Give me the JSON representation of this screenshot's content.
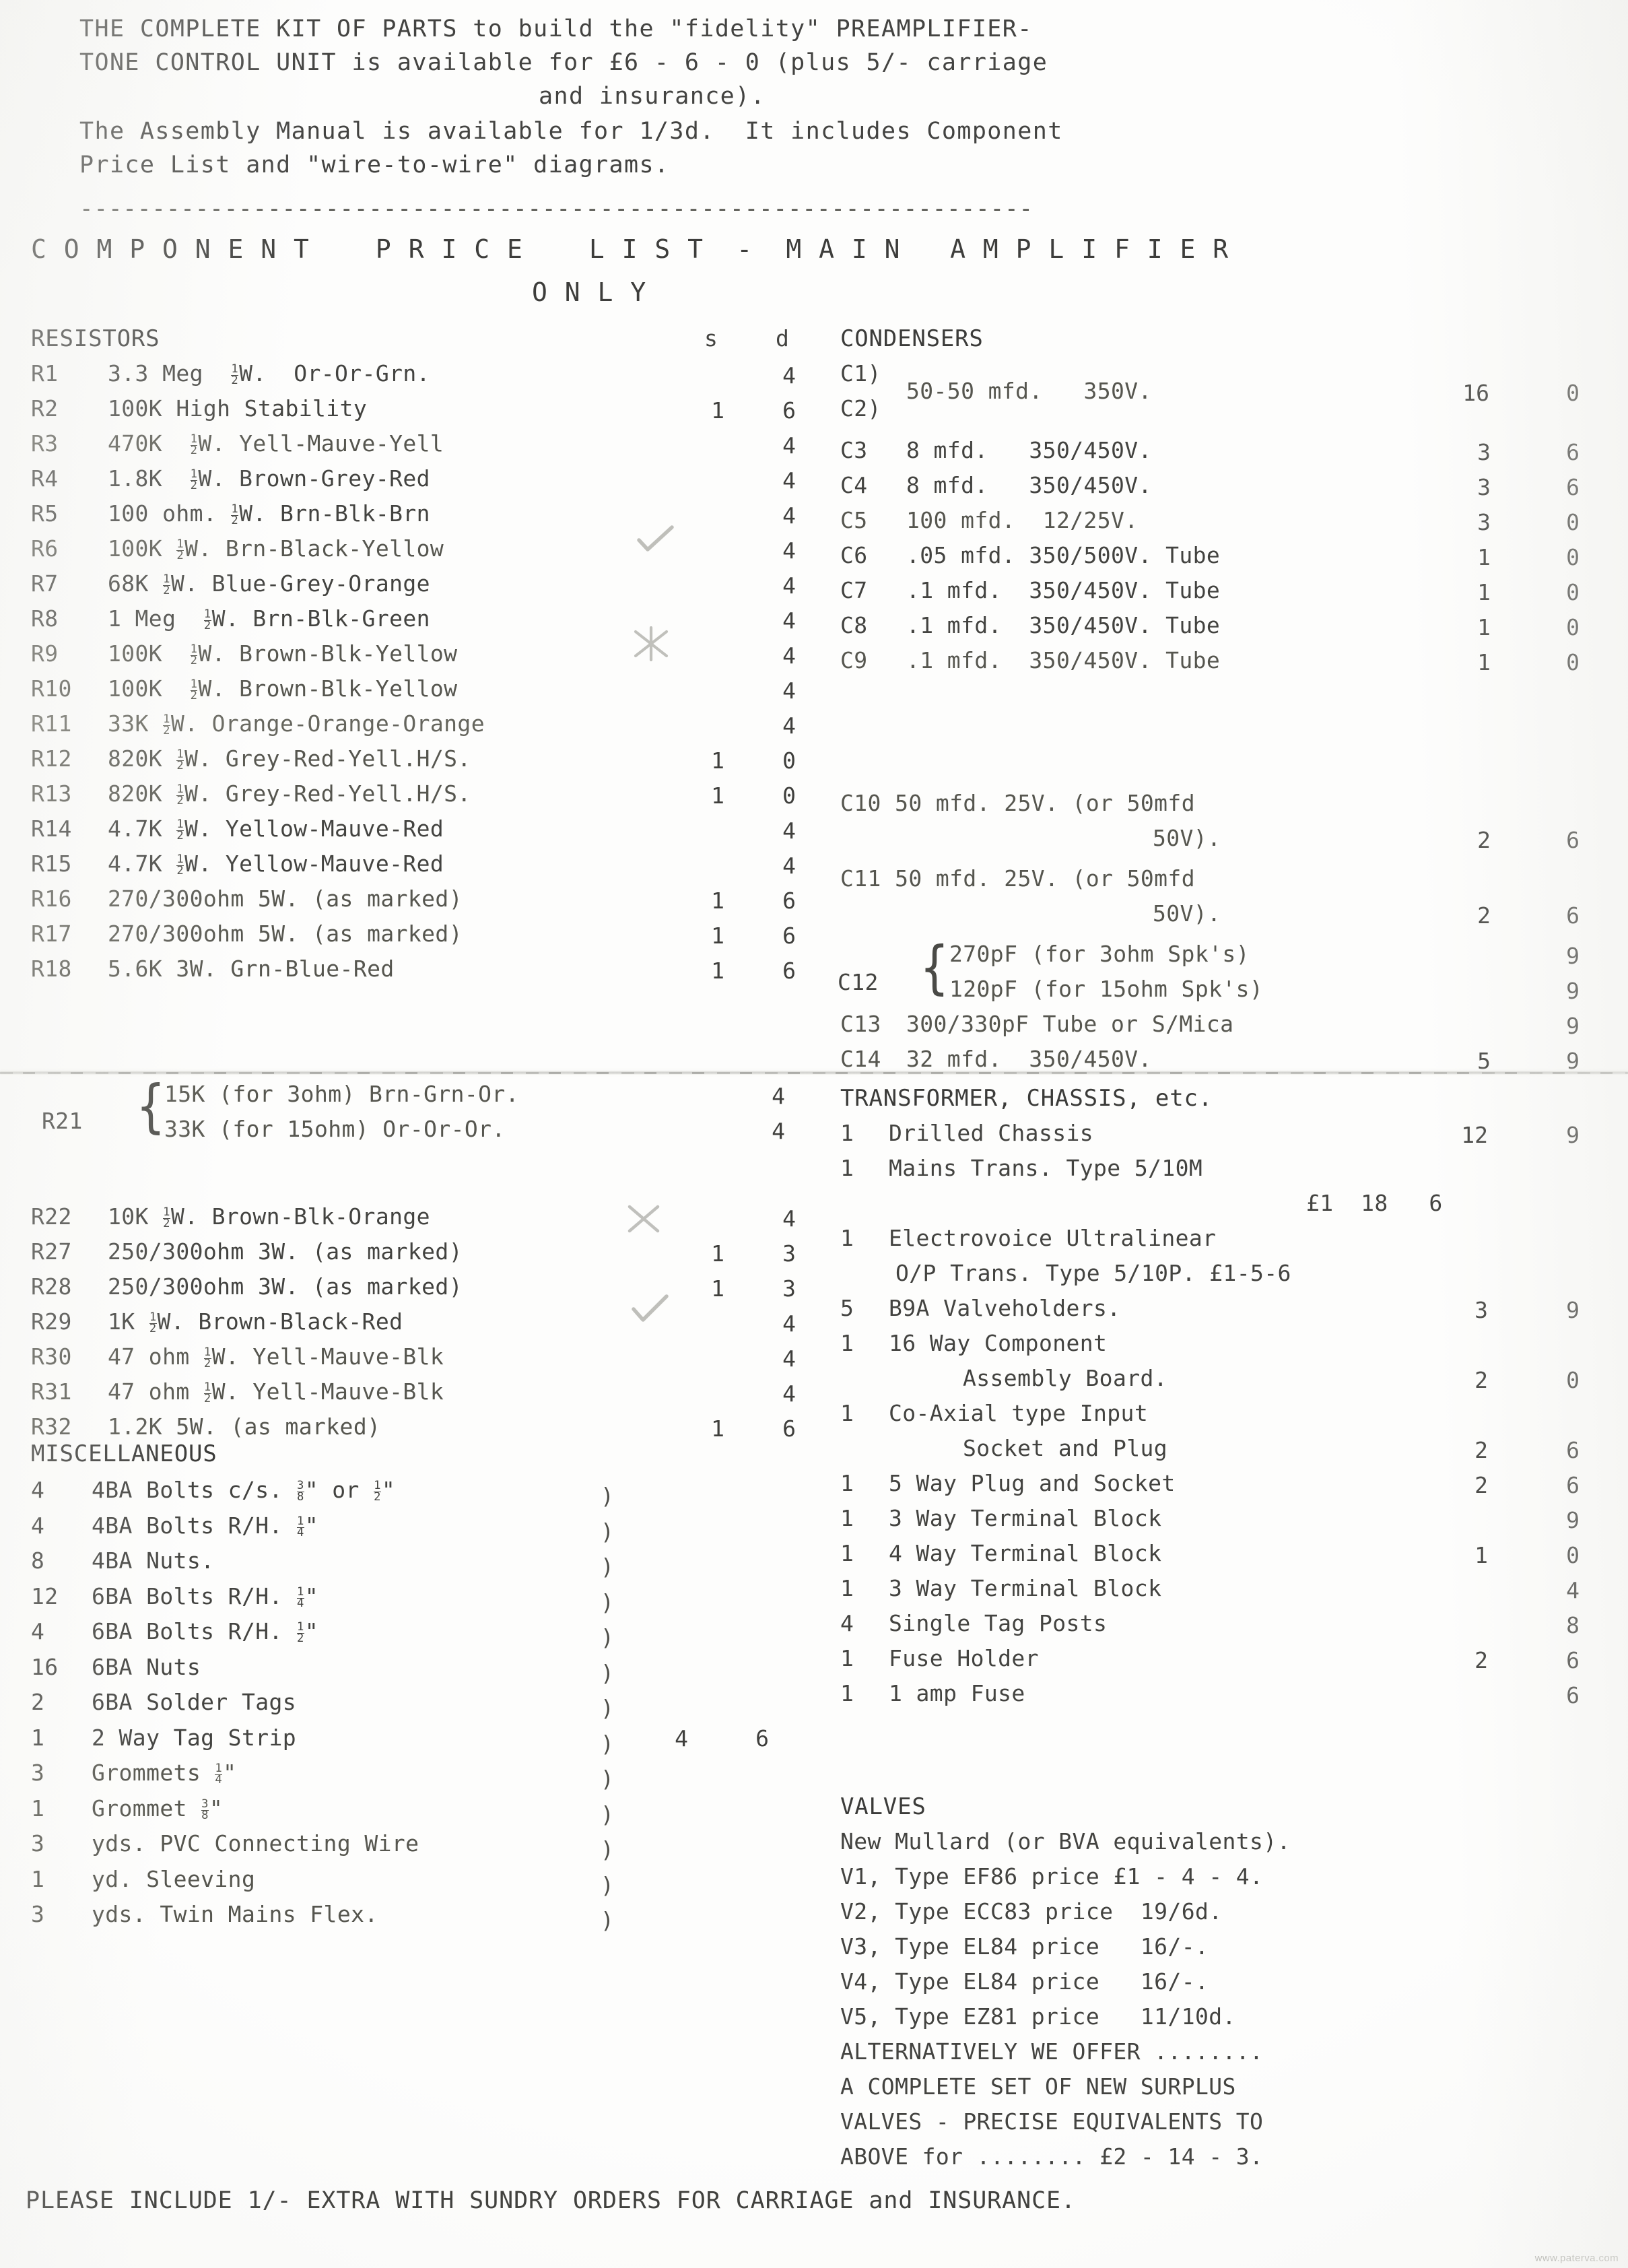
{
  "header": {
    "line1": "THE COMPLETE KIT OF PARTS to build the \"fidelity\" PREAMPLIFIER-",
    "line2": "TONE CONTROL UNIT is available for £6 - 6 - 0 (plus 5/- carriage",
    "line3": "and insurance).",
    "line4": "The Assembly Manual is available for 1/3d.  It includes Component",
    "line5": "Price List and \"wire-to-wire\" diagrams.",
    "divider": "------------------------------------------------------------------"
  },
  "title": {
    "line1": "C O M P O N E N T    P R I C E    L I S T  -  M A I N   A M P L I F I E R",
    "line2": "O N L Y"
  },
  "columns": {
    "shillings_header": "s",
    "pence_header": "d"
  },
  "resistors": {
    "heading": "RESISTORS",
    "items": [
      {
        "ref": "R1",
        "desc": "3.3 Meg  ½W.  Or-Or-Grn.",
        "s": "",
        "d": "4"
      },
      {
        "ref": "R2",
        "desc": "100K High Stability",
        "s": "1",
        "d": "6"
      },
      {
        "ref": "R3",
        "desc": "470K  ½W. Yell-Mauve-Yell",
        "s": "",
        "d": "4"
      },
      {
        "ref": "R4",
        "desc": "1.8K  ½W. Brown-Grey-Red",
        "s": "",
        "d": "4"
      },
      {
        "ref": "R5",
        "desc": "100 ohm. ½W. Brn-Blk-Brn",
        "s": "",
        "d": "4"
      },
      {
        "ref": "R6",
        "desc": "100K ½W. Brn-Black-Yellow",
        "s": "",
        "d": "4"
      },
      {
        "ref": "R7",
        "desc": "68K ½W. Blue-Grey-Orange",
        "s": "",
        "d": "4"
      },
      {
        "ref": "R8",
        "desc": "1 Meg  ½W. Brn-Blk-Green",
        "s": "",
        "d": "4"
      },
      {
        "ref": "R9",
        "desc": "100K  ½W. Brown-Blk-Yellow",
        "s": "",
        "d": "4"
      },
      {
        "ref": "R10",
        "desc": "100K  ½W. Brown-Blk-Yellow",
        "s": "",
        "d": "4"
      },
      {
        "ref": "R11",
        "desc": "33K ½W. Orange-Orange-Orange",
        "s": "",
        "d": "4"
      },
      {
        "ref": "R12",
        "desc": "820K ½W. Grey-Red-Yell.H/S.",
        "s": "1",
        "d": "0"
      },
      {
        "ref": "R13",
        "desc": "820K ½W. Grey-Red-Yell.H/S.",
        "s": "1",
        "d": "0"
      },
      {
        "ref": "R14",
        "desc": "4.7K ½W. Yellow-Mauve-Red",
        "s": "",
        "d": "4"
      },
      {
        "ref": "R15",
        "desc": "4.7K ½W. Yellow-Mauve-Red",
        "s": "",
        "d": "4"
      },
      {
        "ref": "R16",
        "desc": "270/300ohm 5W. (as marked)",
        "s": "1",
        "d": "6"
      },
      {
        "ref": "R17",
        "desc": "270/300ohm 5W. (as marked)",
        "s": "1",
        "d": "6"
      },
      {
        "ref": "R18",
        "desc": "5.6K 3W. Grn-Blue-Red",
        "s": "1",
        "d": "6"
      }
    ],
    "r21": {
      "ref": "R21",
      "line_a": "15K (for 3ohm) Brn-Grn-Or.",
      "line_b": "33K (for 15ohm) Or-Or-Or.",
      "d_a": "4",
      "d_b": "4"
    },
    "items_after": [
      {
        "ref": "R22",
        "desc": "10K ½W. Brown-Blk-Orange",
        "s": "",
        "d": "4"
      },
      {
        "ref": "R27",
        "desc": "250/300ohm 3W. (as marked)",
        "s": "1",
        "d": "3"
      },
      {
        "ref": "R28",
        "desc": "250/300ohm 3W. (as marked)",
        "s": "1",
        "d": "3"
      },
      {
        "ref": "R29",
        "desc": "1K ½W. Brown-Black-Red",
        "s": "",
        "d": "4"
      },
      {
        "ref": "R30",
        "desc": "47 ohm ½W. Yell-Mauve-Blk",
        "s": "",
        "d": "4"
      },
      {
        "ref": "R31",
        "desc": "47 ohm ½W. Yell-Mauve-Blk",
        "s": "",
        "d": "4"
      },
      {
        "ref": "R32",
        "desc": "1.2K 5W. (as marked)",
        "s": "1",
        "d": "6"
      }
    ]
  },
  "miscellaneous": {
    "heading": "MISCELLANEOUS",
    "items": [
      {
        "qty": "4",
        "desc": "4BA Bolts c/s. ⅜\" or ½\""
      },
      {
        "qty": "4",
        "desc": "4BA Bolts R/H. ¼\""
      },
      {
        "qty": "8",
        "desc": "4BA Nuts."
      },
      {
        "qty": "12",
        "desc": "6BA Bolts R/H. ¼\""
      },
      {
        "qty": "4",
        "desc": "6BA Bolts R/H. ½\""
      },
      {
        "qty": "16",
        "desc": "6BA Nuts"
      },
      {
        "qty": "2",
        "desc": "6BA Solder Tags"
      },
      {
        "qty": "1",
        "desc": "2 Way Tag Strip"
      },
      {
        "qty": "3",
        "desc": "Grommets ¼\""
      },
      {
        "qty": "1",
        "desc": "Grommet ⅜\""
      },
      {
        "qty": "3",
        "desc": "yds. PVC Connecting Wire"
      },
      {
        "qty": "1",
        "desc": "yd. Sleeving"
      },
      {
        "qty": "3",
        "desc": "yds. Twin Mains Flex."
      }
    ],
    "group_price": {
      "s": "4",
      "d": "6"
    }
  },
  "condensers": {
    "heading": "CONDENSERS",
    "c1c2": {
      "ref_a": "C1)",
      "ref_b": "C2)",
      "desc": "50-50 mfd.   350V.",
      "s": "16",
      "d": "0"
    },
    "items": [
      {
        "ref": "C3",
        "desc": "8 mfd.   350/450V.",
        "s": "3",
        "d": "6"
      },
      {
        "ref": "C4",
        "desc": "8 mfd.   350/450V.",
        "s": "3",
        "d": "6"
      },
      {
        "ref": "C5",
        "desc": "100 mfd.  12/25V.",
        "s": "3",
        "d": "0"
      },
      {
        "ref": "C6",
        "desc": ".05 mfd. 350/500V. Tube",
        "s": "1",
        "d": "0"
      },
      {
        "ref": "C7",
        "desc": ".1 mfd.  350/450V. Tube",
        "s": "1",
        "d": "0"
      },
      {
        "ref": "C8",
        "desc": ".1 mfd.  350/450V. Tube",
        "s": "1",
        "d": "0"
      },
      {
        "ref": "C9",
        "desc": ".1 mfd.  350/450V. Tube",
        "s": "1",
        "d": "0"
      }
    ],
    "c10": {
      "line_a": "C10 50 mfd. 25V. (or 50mfd",
      "line_b": "50V).",
      "s": "2",
      "d": "6"
    },
    "c11": {
      "line_a": "C11 50 mfd. 25V. (or 50mfd",
      "line_b": "50V).",
      "s": "2",
      "d": "6"
    },
    "c12": {
      "ref": "C12",
      "line_a": "270pF (for 3ohm Spk's)",
      "line_b": "120pF (for 15ohm Spk's)",
      "d_a": "9",
      "d_b": "9"
    },
    "items_after": [
      {
        "ref": "C13",
        "desc": "300/330pF Tube or S/Mica",
        "s": "",
        "d": "9"
      },
      {
        "ref": "C14",
        "desc": "32 mfd.  350/450V.",
        "s": "5",
        "d": "9"
      }
    ]
  },
  "transformer": {
    "heading": "TRANSFORMER, CHASSIS, etc.",
    "items": [
      {
        "qty": "1",
        "desc": "Drilled Chassis",
        "desc2": "",
        "s": "12",
        "d": "9"
      },
      {
        "qty": "1",
        "desc": "Mains Trans. Type 5/10M",
        "desc2": "£1  18   6",
        "s": "",
        "d": "",
        "pound": true
      },
      {
        "qty": "1",
        "desc": "Electrovoice Ultralinear",
        "desc2": "O/P Trans. Type 5/10P. £1-5-6",
        "s": "",
        "d": ""
      },
      {
        "qty": "5",
        "desc": "B9A Valveholders.",
        "desc2": "",
        "s": "3",
        "d": "9"
      },
      {
        "qty": "1",
        "desc": "16 Way Component",
        "desc2": "Assembly Board.",
        "s": "2",
        "d": "0"
      },
      {
        "qty": "1",
        "desc": "Co-Axial type Input",
        "desc2": "Socket and Plug",
        "s": "2",
        "d": "6"
      },
      {
        "qty": "1",
        "desc": "5 Way Plug and Socket",
        "desc2": "",
        "s": "2",
        "d": "6"
      },
      {
        "qty": "1",
        "desc": "3 Way Terminal Block",
        "desc2": "",
        "s": "",
        "d": "9"
      },
      {
        "qty": "1",
        "desc": "4 Way Terminal Block",
        "desc2": "",
        "s": "1",
        "d": "0"
      },
      {
        "qty": "1",
        "desc": "3 Way Terminal Block",
        "desc2": "",
        "s": "",
        "d": "4"
      },
      {
        "qty": "4",
        "desc": "Single Tag Posts",
        "desc2": "",
        "s": "",
        "d": "8"
      },
      {
        "qty": "1",
        "desc": "Fuse Holder",
        "desc2": "",
        "s": "2",
        "d": "6"
      },
      {
        "qty": "1",
        "desc": "1 amp Fuse",
        "desc2": "",
        "s": "",
        "d": "6"
      }
    ]
  },
  "valves": {
    "heading": "VALVES",
    "note": "New Mullard (or BVA equivalents).",
    "items": [
      "V1, Type EF86 price £1 - 4 - 4.",
      "V2, Type ECC83 price  19/6d.",
      "V3, Type EL84 price   16/-.",
      "V4, Type EL84 price   16/-.",
      "V5, Type EZ81 price   11/10d."
    ],
    "alt_lines": [
      "ALTERNATIVELY WE OFFER ........",
      "A COMPLETE SET OF NEW SURPLUS",
      "VALVES - PRECISE EQUIVALENTS TO",
      "ABOVE for ........ £2 - 14 - 3."
    ]
  },
  "footer": {
    "text": "PLEASE INCLUDE 1/- EXTRA WITH SUNDRY ORDERS FOR CARRIAGE and INSURANCE."
  },
  "watermark": {
    "text": "www.paterva.com"
  },
  "annotations": {
    "check_r4": "pencil-check",
    "cross_r6": "pencil-cross",
    "cross_r22": "pencil-cross",
    "check_r29": "pencil-check"
  }
}
